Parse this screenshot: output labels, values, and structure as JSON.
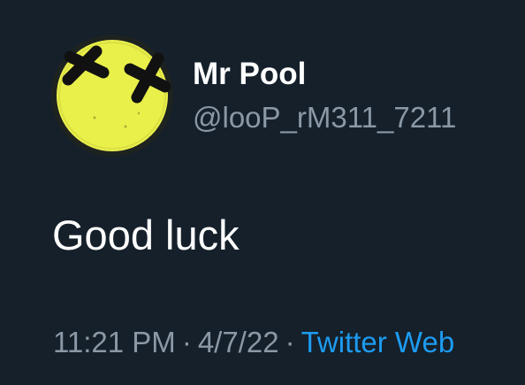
{
  "tweet": {
    "user": {
      "display_name": "Mr Pool",
      "handle": "@looP_rM311_7211",
      "avatar_icon": "smiley-x-eyes-icon"
    },
    "text": "Good luck",
    "meta": {
      "time": "11:21 PM",
      "date": "4/7/22",
      "separator": "·",
      "source": "Twitter Web"
    }
  },
  "colors": {
    "background": "#15202b",
    "primary_text": "#ffffff",
    "secondary_text": "#8b98a5",
    "link": "#1d9bf0",
    "avatar_yellow": "#eaf04a"
  }
}
